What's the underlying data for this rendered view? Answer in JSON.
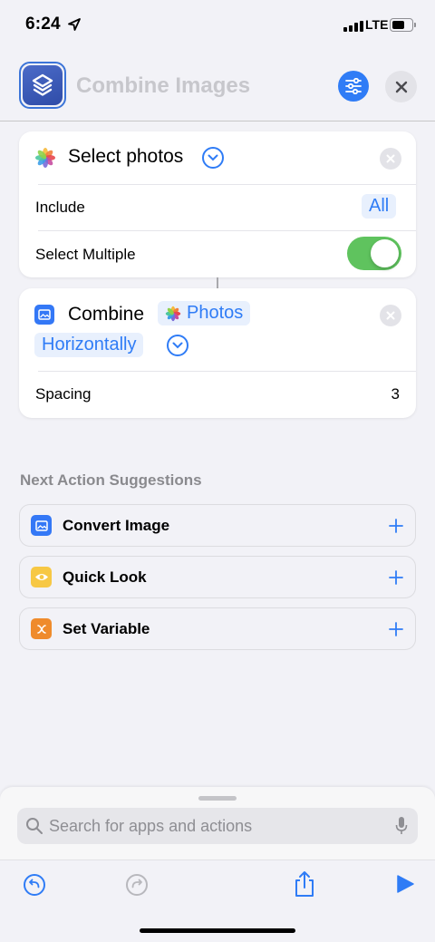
{
  "status_bar": {
    "time": "6:24",
    "network": "LTE"
  },
  "header": {
    "title": "Combine Images",
    "icons": {
      "app": "shortcut-stack-icon",
      "settings": "sliders-icon",
      "close": "close-icon"
    },
    "accent": "#2f7cf6"
  },
  "select_photos": {
    "title": "Select photos",
    "include_label": "Include",
    "include_value": "All",
    "multiple_label": "Select Multiple",
    "multiple_on": true
  },
  "combine": {
    "title": "Combine",
    "input_token": "Photos",
    "mode": "Horizontally",
    "spacing_label": "Spacing",
    "spacing_value": "3"
  },
  "suggestions": {
    "header": "Next Action Suggestions",
    "items": [
      {
        "label": "Convert Image",
        "icon": "image-icon",
        "color": "#3478f6"
      },
      {
        "label": "Quick Look",
        "icon": "eye-icon",
        "color": "#f7c844"
      },
      {
        "label": "Set Variable",
        "icon": "variable-x-icon",
        "color": "#ef8b2c"
      }
    ]
  },
  "search": {
    "placeholder": "Search for apps and actions"
  },
  "toolbar": {
    "icons": [
      "undo-icon",
      "redo-icon",
      "share-icon",
      "play-icon"
    ]
  }
}
